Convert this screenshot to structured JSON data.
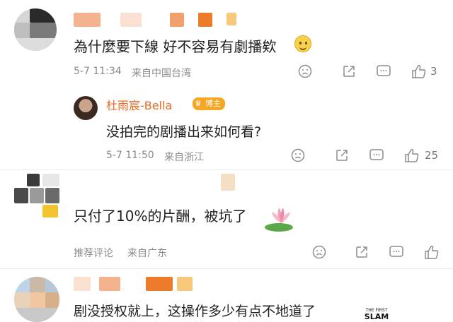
{
  "comments": [
    {
      "text": "為什麼要下線 好不容易有劇播欸",
      "time": "5-7 11:34",
      "location": "来自中国台湾",
      "likes": "3"
    },
    {
      "name": "杜雨宸-Bella",
      "badge": "博主",
      "text": "没拍完的剧播出来如何看?",
      "time": "5-7 11:50",
      "location": "来自浙江",
      "likes": "25"
    },
    {
      "text": "只付了10%的片酬，被坑了",
      "time": "推荐评论",
      "location": "来自广东"
    },
    {
      "text": "剧没授权就上，这操作多少有点不地道了"
    }
  ],
  "watermark": {
    "line1": "THE FIRST",
    "line2": "SLAM"
  },
  "colors": {
    "name": "#e86a1f",
    "meta": "#8a8a8a",
    "icon": "#8c8c8c"
  }
}
